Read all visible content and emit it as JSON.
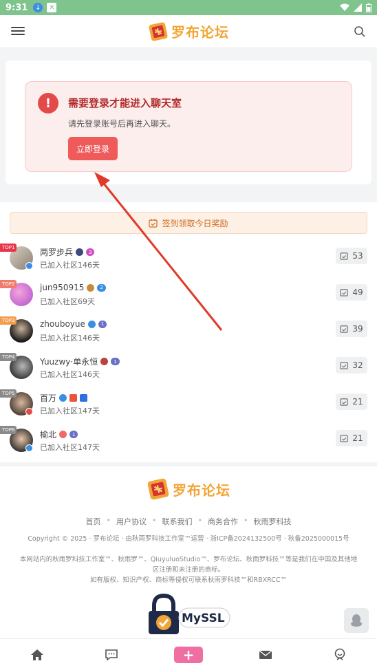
{
  "statusbar": {
    "time": "9:31"
  },
  "header": {
    "logo_text": "罗布论坛"
  },
  "login": {
    "title": "需要登录才能进入聊天室",
    "desc": "请先登录账号后再进入聊天。",
    "button": "立即登录"
  },
  "checkin": {
    "label": "签到领取今日奖励"
  },
  "ranking": [
    {
      "badge": "TOP1",
      "badge_color": "#e8354b",
      "name": "两罗步兵",
      "days": "已加入社区146天",
      "score": "53"
    },
    {
      "badge": "TOP2",
      "badge_color": "#f07b6a",
      "name": "jun950915",
      "days": "已加入社区69天",
      "score": "49"
    },
    {
      "badge": "TOP3",
      "badge_color": "#f29d4a",
      "name": "zhouboyue",
      "days": "已加入社区146天",
      "score": "39"
    },
    {
      "badge": "TOP4",
      "badge_color": "#8a8a8a",
      "name": "Yuuzwy·单永恒",
      "days": "已加入社区146天",
      "score": "32"
    },
    {
      "badge": "TOP5",
      "badge_color": "#8a8a8a",
      "name": "百万",
      "days": "已加入社区147天",
      "score": "21"
    },
    {
      "badge": "TOP6",
      "badge_color": "#8a8a8a",
      "name": "榆北",
      "days": "已加入社区147天",
      "score": "21"
    }
  ],
  "footer": {
    "logo_text": "罗布论坛",
    "links": [
      "首页",
      "用户协议",
      "联系我们",
      "商务合作",
      "秋雨罗科技"
    ],
    "copyright": "Copyright © 2025 · 罗布论坛 · 由秋雨罗科技工作室™运营 · 浙ICP备2024132500号 · 秋备2025000015号",
    "notice_1": "本网站内的秋雨罗科技工作室™、秋雨罗™、QiuyuluoStudio™、罗布论坛、秋雨罗科技™等是我们在中国及其他地区注册和未注册的商标。",
    "notice_2": "如有版权、知识产权、商标等侵权可联系秋雨罗科技™和RBXRCC™",
    "ssl_text": "MySSL"
  }
}
